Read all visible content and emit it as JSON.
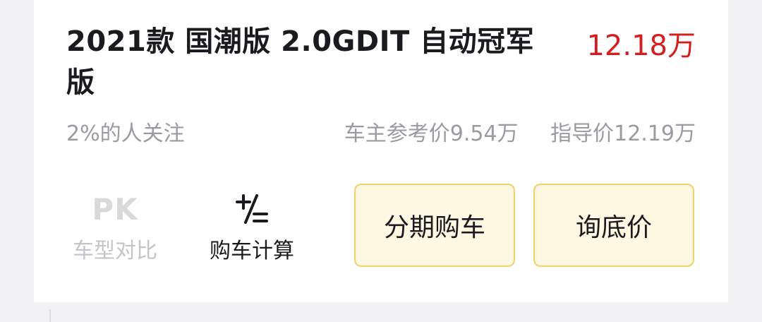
{
  "trim": {
    "title": "2021款 国潮版 2.0GDIT 自动冠军版",
    "price": "12.18万"
  },
  "stats": {
    "attention": "2%的人关注",
    "owner_price": "车主参考价9.54万",
    "guide_price": "指导价12.19万"
  },
  "tools": {
    "compare": {
      "glyph": "PK",
      "label": "车型对比"
    },
    "calculator": {
      "label": "购车计算"
    }
  },
  "actions": {
    "installment_label": "分期购车",
    "inquiry_label": "询底价"
  },
  "colors": {
    "price": "#d41f1f",
    "button_bg": "#fdf8e1",
    "button_border": "#efd26b",
    "muted_text": "#9a9ba0"
  }
}
